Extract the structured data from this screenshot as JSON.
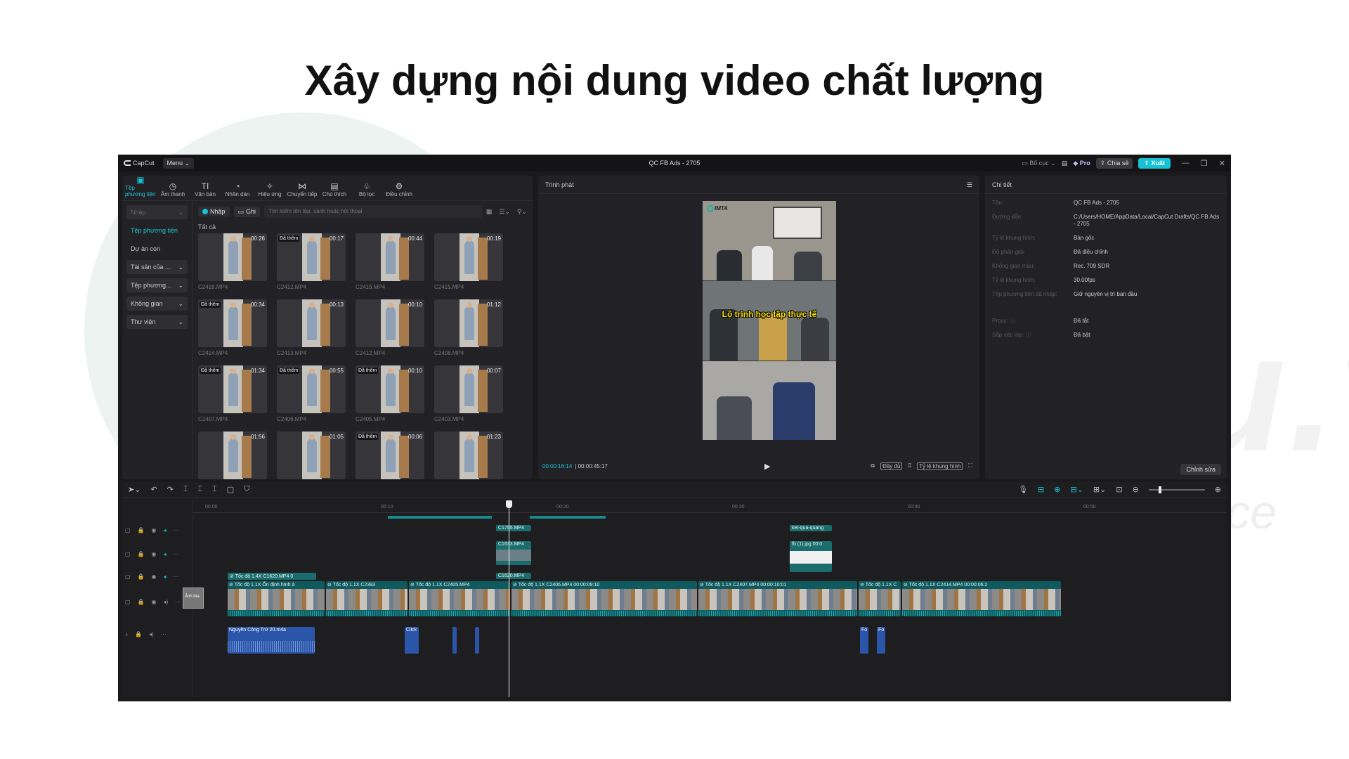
{
  "slide": {
    "title": "Xây dựng nội dung video chất lượng",
    "watermark": "IMTA.edu.vn",
    "watermark_sub": "Internet Marketing Target Audience"
  },
  "app": {
    "logo": "CapCut",
    "menu": "Menu",
    "project_title": "QC FB Ads - 2705",
    "layout": "Bố cục",
    "pro": "Pro",
    "share": "Chia sẻ",
    "export": "Xuất",
    "accent": "#19c3d6"
  },
  "toolbar": [
    {
      "icon": "media-icon",
      "glyph": "▣",
      "label": "Tệp phương tiện",
      "active": true
    },
    {
      "icon": "audio-icon",
      "glyph": "◷",
      "label": "Âm thanh"
    },
    {
      "icon": "text-icon",
      "glyph": "TI",
      "label": "Văn bản"
    },
    {
      "icon": "sticker-icon",
      "glyph": "◔",
      "label": "Nhãn dán"
    },
    {
      "icon": "effects-icon",
      "glyph": "✧",
      "label": "Hiệu ứng"
    },
    {
      "icon": "transition-icon",
      "glyph": "⋈",
      "label": "Chuyển tiếp"
    },
    {
      "icon": "captions-icon",
      "glyph": "▤",
      "label": "Chú thích"
    },
    {
      "icon": "filter-icon",
      "glyph": "♧",
      "label": "Bộ lọc"
    },
    {
      "icon": "adjust-icon",
      "glyph": "⚙",
      "label": "Điều chỉnh"
    }
  ],
  "sidenav": [
    {
      "label": "Nhập",
      "caret": "⌄",
      "style": "boxed muted"
    },
    {
      "label": "Tệp phương tiện",
      "caret": "",
      "style": "active"
    },
    {
      "label": "Dự án con",
      "caret": "",
      "style": ""
    },
    {
      "label": "Tài sản của ...",
      "caret": "⌄",
      "style": "boxed"
    },
    {
      "label": "Tệp phương...",
      "caret": "⌄",
      "style": "boxed"
    },
    {
      "label": "Không gian",
      "caret": "⌄",
      "style": "boxed"
    },
    {
      "label": "Thư viện",
      "caret": "⌄",
      "style": "boxed"
    }
  ],
  "media": {
    "import": "Nhập",
    "record": "Ghi",
    "search_placeholder": "Tìm kiếm tên tệp, cảnh hoặc hội thoại",
    "all": "Tất cả",
    "clips": [
      {
        "dur": "00:26",
        "name": "C2418.MP4",
        "added": ""
      },
      {
        "dur": "00:17",
        "name": "C2412.MP4",
        "added": "Đã thêm"
      },
      {
        "dur": "00:44",
        "name": "C2416.MP4",
        "added": ""
      },
      {
        "dur": "00:19",
        "name": "C2415.MP4",
        "added": ""
      },
      {
        "dur": "00:34",
        "name": "C2414.MP4",
        "added": "Đã thêm"
      },
      {
        "dur": "00:13",
        "name": "C2413.MP4",
        "added": ""
      },
      {
        "dur": "00:10",
        "name": "C2412.MP4",
        "added": ""
      },
      {
        "dur": "01:12",
        "name": "C2408.MP4",
        "added": ""
      },
      {
        "dur": "01:34",
        "name": "C2407.MP4",
        "added": "Đã thêm"
      },
      {
        "dur": "00:55",
        "name": "C2406.MP4",
        "added": "Đã thêm"
      },
      {
        "dur": "00:10",
        "name": "C2405.MP4",
        "added": "Đã thêm"
      },
      {
        "dur": "00:07",
        "name": "C2403.MP4",
        "added": ""
      },
      {
        "dur": "01:56",
        "name": "",
        "added": ""
      },
      {
        "dur": "01:05",
        "name": "",
        "added": ""
      },
      {
        "dur": "00:06",
        "name": "",
        "added": "Đã thêm"
      },
      {
        "dur": "01:23",
        "name": "",
        "added": ""
      }
    ]
  },
  "player": {
    "title": "Trình phát",
    "video_logo": "IMTA",
    "caption": "Lộ trình học tập thực tế",
    "current": "00:00:16:14",
    "total": "00:00:45:17",
    "full": "Đầy đủ",
    "ratio": "Tỷ lệ khung hình"
  },
  "details": {
    "title": "Chi tiết",
    "rows": [
      {
        "label": "Tên:",
        "value": "QC FB Ads - 2705"
      },
      {
        "label": "Đường dẫn:",
        "value": "C:/Users/HOME/AppData/Local/CapCut Drafts/QC FB Ads - 2705"
      },
      {
        "label": "Tỷ lệ khung hình:",
        "value": "Bản gốc"
      },
      {
        "label": "Độ phân giải:",
        "value": "Đã điều chỉnh"
      },
      {
        "label": "Không gian màu:",
        "value": "Rec. 709 SDR"
      },
      {
        "label": "Tỷ lệ khung hình:",
        "value": "30.00fps"
      },
      {
        "label": "Tệp phương tiện đã nhập:",
        "value": "Giữ nguyên vị trí ban đầu"
      },
      {
        "label": "Proxy: ⓘ",
        "value": "Đã tắt"
      },
      {
        "label": "Sắp xếp lớp: ⓘ",
        "value": "Đã bật"
      }
    ],
    "edit": "Chỉnh sửa"
  },
  "timeline": {
    "ticks": [
      "00:00",
      "00:10",
      "00:20",
      "00:30",
      "00:40",
      "00:50"
    ],
    "overlay_clips": [
      "C1755.MP4",
      "C1633.MP4",
      "C1620.MP4",
      "ket-qua-quang",
      "fb (1).jpg",
      "00:0"
    ],
    "speed_clip": "Tốc độ 1.4X",
    "speed_clip_name": "C1620.MP4",
    "speed_clip_end": "0",
    "main_clips": [
      {
        "label": "Tốc độ 1.1X   Ổn định hình ả"
      },
      {
        "label": "Tốc độ 1.1X   C2393"
      },
      {
        "label": "Tốc độ 1.1X   C2405.MP4"
      },
      {
        "label": "Tốc độ 1.1X   C2406.MP4   00:00:09:10"
      },
      {
        "label": "Tốc độ 1.1X   C2407.MP4   00:00:10:01"
      },
      {
        "label": "Tốc độ 1.1X   C"
      },
      {
        "label": "Tốc độ 1.1X   C2414.MP4   00:00:06:2"
      }
    ],
    "cover": "Ảnh bìa",
    "audio_clip": "Nguyễn Công Trứ 20.m4a",
    "small_audio": [
      "Click",
      "Fo",
      "Fo"
    ]
  }
}
